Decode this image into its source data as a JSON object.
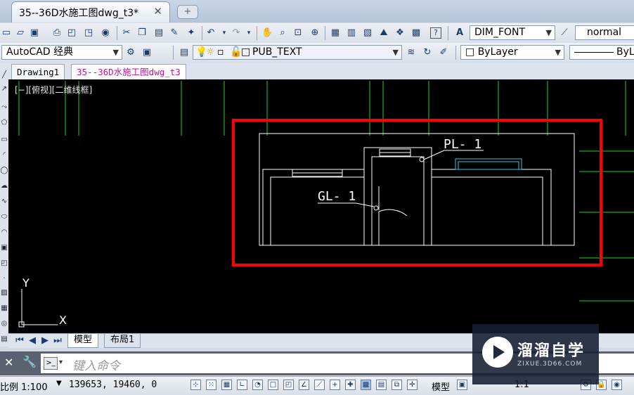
{
  "window": {
    "doc_tab_title": "35--36D水施工图dwg_t3*",
    "close_glyph": "✕",
    "new_tab_glyph": "+"
  },
  "toolbar1": {
    "text_style": "DIM_FONT",
    "dim_style": "normal"
  },
  "toolbar2": {
    "workspace": "AutoCAD 经典",
    "layer": "PUB_TEXT",
    "color": "ByLayer",
    "linetype": "ByL"
  },
  "file_tabs": [
    "Drawing1",
    "35--36D水施工图dwg_t3"
  ],
  "viewport": {
    "label": "[−][俯视][二维线框]"
  },
  "drawing": {
    "label_pl": "PL- 1",
    "label_gl": "GL- 1",
    "ucs_y": "Y",
    "ucs_x": "X",
    "colors": {
      "background": "#000000",
      "lines": "#ffffff",
      "grid": "#1fcf1f",
      "highlight": "#ff0000",
      "window": "#39c6d8"
    }
  },
  "layout_tabs": {
    "model": "模型",
    "layout1": "布局1"
  },
  "command": {
    "placeholder": "键入命令"
  },
  "status": {
    "scale_label": "比例 1:100",
    "coordinates": "139653, 19460, 0",
    "model": "模型",
    "zoom": "1:1"
  },
  "watermark": {
    "name": "溜溜自学",
    "url": "ZIXUE.3D66.COM"
  }
}
